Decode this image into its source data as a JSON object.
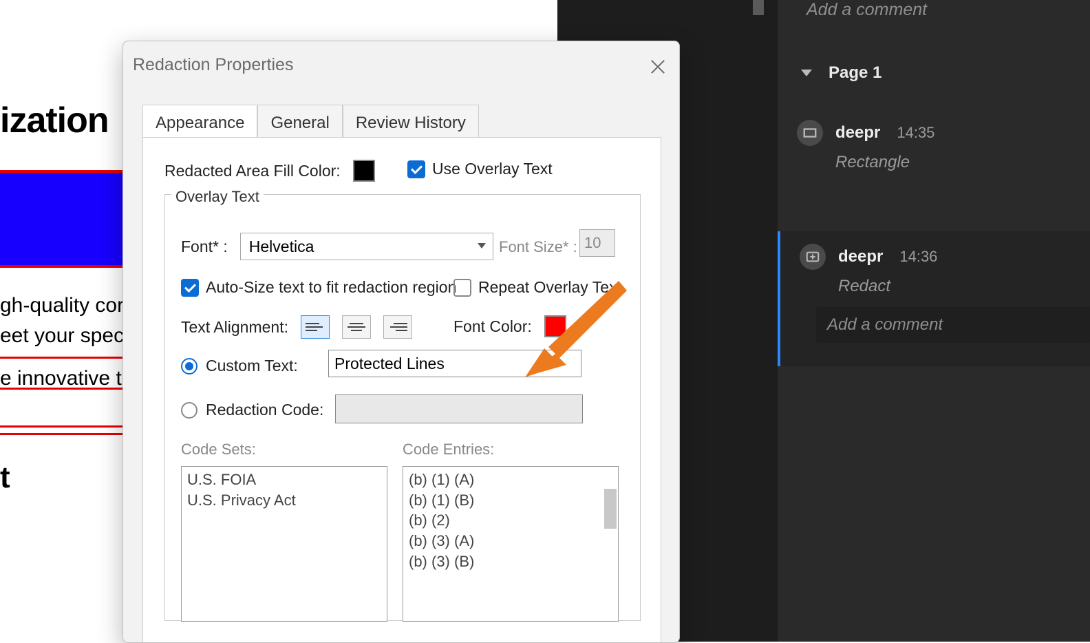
{
  "document": {
    "heading_fragment": "ization",
    "paragraph": "gh-quality cor\neet your spec",
    "textline": "e innovative t",
    "subhead_fragment": "t"
  },
  "dialog": {
    "title": "Redaction Properties",
    "tabs": [
      "Appearance",
      "General",
      "Review History"
    ],
    "active_tab": 0,
    "fill_color_label": "Redacted Area Fill Color:",
    "fill_color": "#000000",
    "use_overlay_label": "Use Overlay Text",
    "use_overlay_checked": true,
    "overlay_legend": "Overlay Text",
    "font_label": "Font* :",
    "font_value": "Helvetica",
    "font_size_label": "Font Size* :",
    "font_size_value": "10",
    "auto_size_label": "Auto-Size text to fit redaction region",
    "auto_size_checked": true,
    "repeat_label": "Repeat Overlay Text",
    "repeat_checked": false,
    "align_label": "Text Alignment:",
    "font_color_label": "Font Color:",
    "font_color": "#ff0000",
    "custom_text_label": "Custom Text:",
    "custom_text_value": "Protected Lines",
    "custom_text_selected": true,
    "redaction_code_label": "Redaction Code:",
    "code_sets_label": "Code Sets:",
    "code_entries_label": "Code Entries:",
    "code_sets": [
      "U.S. FOIA",
      "U.S. Privacy Act"
    ],
    "code_entries": [
      "(b) (1) (A)",
      "(b) (1) (B)",
      "(b) (2)",
      "(b) (3) (A)",
      "(b) (3) (B)"
    ]
  },
  "panel": {
    "add_placeholder": "Add a comment",
    "page_label": "Page 1",
    "comments": [
      {
        "user": "deepr",
        "time": "14:35",
        "type": "Rectangle",
        "icon": "rectangle"
      },
      {
        "user": "deepr",
        "time": "14:36",
        "type": "Redact",
        "icon": "redact"
      }
    ]
  }
}
